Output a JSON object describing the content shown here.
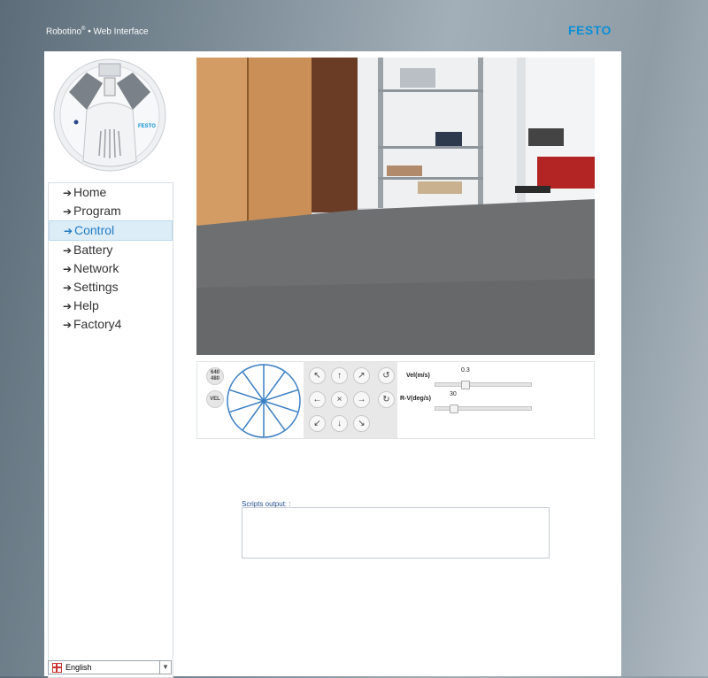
{
  "app": {
    "title_main": "Robotino",
    "title_reg": "®",
    "title_rest": " • Web Interface",
    "brand": "FESTO",
    "brand_color": "#0a8fd6"
  },
  "nav": {
    "items": [
      {
        "label": "Home"
      },
      {
        "label": "Program"
      },
      {
        "label": "Control",
        "active": true
      },
      {
        "label": "Battery"
      },
      {
        "label": "Network"
      },
      {
        "label": "Settings"
      },
      {
        "label": "Help"
      },
      {
        "label": "Factory4"
      }
    ],
    "arrow": "➔",
    "active_color": "#1f7ac3"
  },
  "language": {
    "selected": "English",
    "icon": "uk-flag-icon"
  },
  "robot_image": {
    "brand": "FESTO"
  },
  "controls": {
    "resolution_top": "640",
    "resolution_bottom": "480",
    "vel_button": "VEL",
    "pad": {
      "up_left": "↖",
      "up": "↑",
      "up_right": "↗",
      "rotate_ccw": "↺",
      "left": "←",
      "stop": "×",
      "right": "→",
      "rotate_cw": "↻",
      "down_left": "↙",
      "down": "↓",
      "down_right": "↘"
    },
    "vel_label": "Vel(m/s)",
    "vel_value": "0.3",
    "rv_label": "R-V(deg/s)",
    "rv_value": "30",
    "wheel_color": "#3a7fc4"
  },
  "scripts": {
    "label": "Scripts output: :",
    "content": ""
  }
}
